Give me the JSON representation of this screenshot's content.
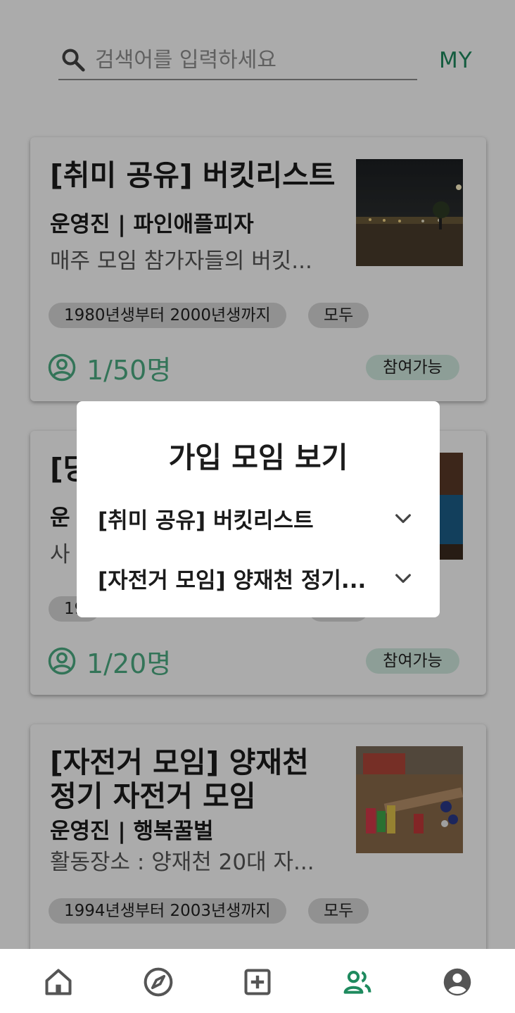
{
  "search": {
    "placeholder": "검색어를 입력하세요",
    "value": ""
  },
  "header": {
    "my_label": "MY"
  },
  "cards": [
    {
      "title": "[취미 공유] 버킷리스트",
      "owner": "운영진 | 파인애플피자",
      "description": "매주 모임 참가자들의 버킷...",
      "age_range": "1980년생부터 2000년생까지",
      "gender": "모두",
      "members": "1/50명",
      "status": "참여가능"
    },
    {
      "title": "[당",
      "owner": "운",
      "description": "사",
      "age_range": "19",
      "gender": "",
      "members": "1/20명",
      "status": "참여가능"
    },
    {
      "title": "[자전거 모임] 양재천 정기 자전거 모임",
      "owner": "운영진 | 행복꿀벌",
      "description": "활동장소 : 양재천 20대 자...",
      "age_range": "1994년생부터 2003년생까지",
      "gender": "모두"
    }
  ],
  "dialog": {
    "title": "가입 모임 보기",
    "items": [
      {
        "label": "[취미 공유] 버킷리스트"
      },
      {
        "label": "[자전거 모임] 양재천 정기..."
      }
    ]
  },
  "nav": {
    "items": [
      "home-icon",
      "compass-icon",
      "add-box-icon",
      "group-icon",
      "account-icon"
    ],
    "active_color": "#1e8a5e",
    "inactive_color": "#555555"
  },
  "colors": {
    "accent": "#1e8a5e",
    "members_green": "#4cae84",
    "status_bg": "#d3ece1",
    "tag_bg": "#d8d8d8"
  }
}
